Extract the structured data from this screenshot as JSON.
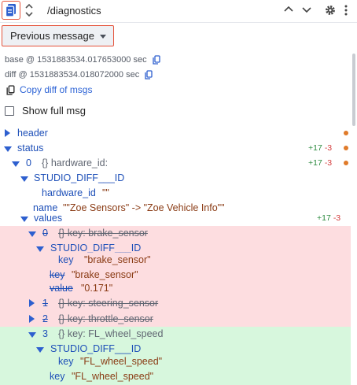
{
  "toolbar": {
    "topic": "/diagnostics"
  },
  "diff_button": {
    "label": "Previous message"
  },
  "info": {
    "base": "base @ 1531883534.017653000 sec",
    "diff": "diff @ 1531883534.018072000 sec",
    "copy_diff": "Copy diff of msgs",
    "show_full": "Show full msg"
  },
  "tree": {
    "header": "header",
    "status": "status",
    "status_badge": {
      "plus": "+17",
      "minus": "-3"
    },
    "idx0": "0",
    "idx0_desc": "{}  hardware_id:",
    "idx0_badge": {
      "plus": "+17",
      "minus": "-3"
    },
    "studio_diff_id_1": "STUDIO_DIFF___ID",
    "hardware_id_key": "hardware_id",
    "hardware_id_val": "\"\"",
    "name_key": "name",
    "name_val": "\"\"Zoe Sensors\" -> \"Zoe Vehicle Info\"\"",
    "values": "values",
    "values_badge": {
      "plus": "+17",
      "minus": "-3"
    },
    "v0_idx": "0",
    "v0_desc": "{}  key: brake_sensor",
    "studio_diff_id_2": "STUDIO_DIFF___ID",
    "v0_sub_key": "key",
    "v0_sub_val": "\"brake_sensor\"",
    "v0_key_key": "key",
    "v0_key_val": "\"brake_sensor\"",
    "v0_value_key": "value",
    "v0_value_val": "\"0.171\"",
    "v1_idx": "1",
    "v1_desc": "{}  key: steering_sensor",
    "v2_idx": "2",
    "v2_desc": "{}  key: throttle_sensor",
    "v3_idx": "3",
    "v3_desc": "{}  key: FL_wheel_speed",
    "studio_diff_id_3": "STUDIO_DIFF___ID",
    "v3_sub_key": "key",
    "v3_sub_val": "\"FL_wheel_speed\"",
    "v3_key_key": "key",
    "v3_key_val": "\"FL_wheel_speed\""
  },
  "colors": {
    "accent": "#2d5fcf",
    "highlight_border": "#e5533b",
    "removed_bg": "#fddde0",
    "added_bg": "#d7f7dd",
    "change_dot": "#e07b2a"
  }
}
